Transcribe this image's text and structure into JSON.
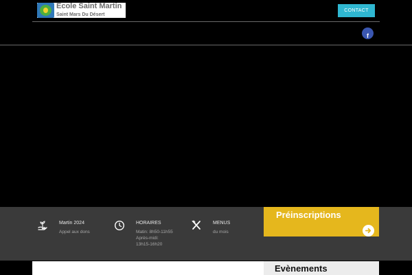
{
  "header": {
    "logo_title": "Ecole Saint Martin",
    "logo_subtitle": "Saint Mars Du Désert",
    "contact_label": "CONTACT",
    "facebook_glyph": "f"
  },
  "info": [
    {
      "icon": "hand-plant-icon",
      "label": "Martin 2024",
      "sub": [
        "Appel aux dons"
      ]
    },
    {
      "icon": "clock-icon",
      "label": "HORAIRES",
      "sub": [
        "Matin: 8h50-11h55",
        "Après-midi:",
        "13h15-16h20"
      ]
    },
    {
      "icon": "utensils-icon",
      "label": "MENUS",
      "sub": [
        "du mois"
      ]
    }
  ],
  "preinscriptions": {
    "title": "Préinscriptions"
  },
  "events": {
    "title": "Evènements"
  },
  "colors": {
    "accent_cyan": "#2fb7d1",
    "accent_yellow": "#e5b71d",
    "band": "#3a3a3a",
    "facebook": "#3a56b0"
  }
}
